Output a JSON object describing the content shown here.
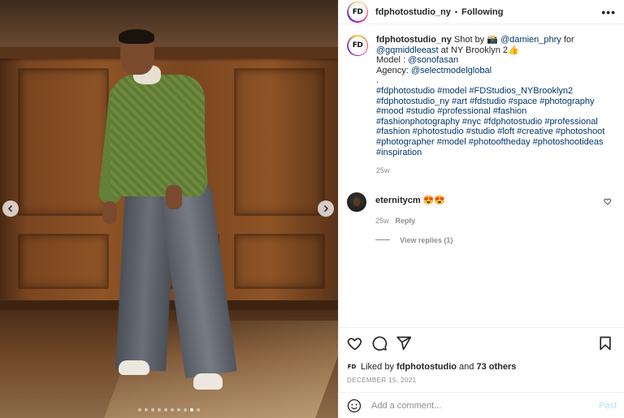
{
  "post": {
    "username": "fdphotostudio_ny",
    "separator": "•",
    "follow_state": "Following",
    "more_label": "•••",
    "avatar_text": "FD"
  },
  "caption": {
    "username": "fdphotostudio_ny",
    "text_1": "Shot by 📸",
    "mention_1": "@damien_phry",
    "text_2": " for",
    "mention_2": "@gqmiddleeast",
    "text_3": " at NY Brooklyn 2👍",
    "model_label": "Model : ",
    "model_mention": "@sonofasan",
    "agency_label": "Agency: ",
    "agency_mention": "@selectmodelglobal",
    "dot": ".",
    "hashtags": "#fdphotostudio #model #FDStudios_NYBrooklyn2 #fdphotostudio_ny #art #fdstudio #space #photography #mood #studio #professional #fashion #fashionphotography #nyc #fdphotostudio #professional #fashion #photostudio #studio #loft #creative #photoshoot #photographer #model #photooftheday #photoshootideas #inspiration",
    "time": "25w"
  },
  "comment": {
    "username": "eternitycm",
    "text": "😍😍",
    "time": "25w",
    "reply_label": "Reply",
    "view_replies": "View replies (1)"
  },
  "engagement": {
    "liked_by_prefix": "Liked by ",
    "liked_by_user": "fdphotostudio",
    "liked_by_and": " and ",
    "others": "73 others",
    "date": "DECEMBER 15, 2021"
  },
  "composer": {
    "placeholder": "Add a comment...",
    "post_label": "Post"
  },
  "carousel": {
    "slide_count": 10,
    "active_index": 8
  },
  "colors": {
    "link": "#00376b",
    "post_disabled": "#b2dffc",
    "meta_gray": "#8e8e8e"
  }
}
